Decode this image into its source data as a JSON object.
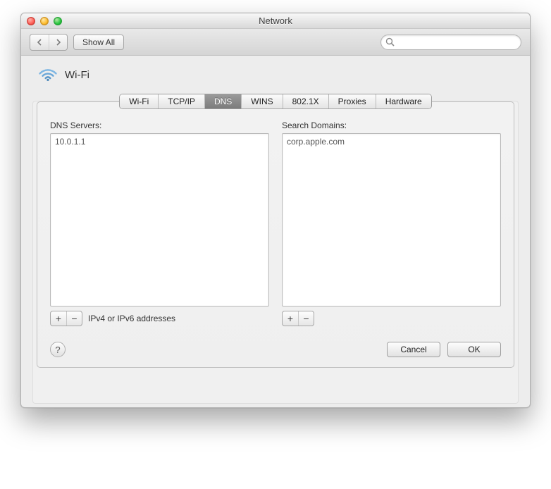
{
  "window": {
    "title": "Network"
  },
  "toolbar": {
    "show_all": "Show All",
    "search_placeholder": ""
  },
  "connection": {
    "name": "Wi-Fi"
  },
  "tabs": {
    "wifi": "Wi-Fi",
    "tcpip": "TCP/IP",
    "dns": "DNS",
    "wins": "WINS",
    "dot1x": "802.1X",
    "proxies": "Proxies",
    "hardware": "Hardware",
    "active": "dns"
  },
  "dns": {
    "servers_label": "DNS Servers:",
    "servers": [
      "10.0.1.1"
    ],
    "hint": "IPv4 or IPv6 addresses",
    "domains_label": "Search Domains:",
    "domains": [
      "corp.apple.com"
    ]
  },
  "buttons": {
    "help": "?",
    "cancel": "Cancel",
    "ok": "OK",
    "plus": "+",
    "minus": "−"
  }
}
